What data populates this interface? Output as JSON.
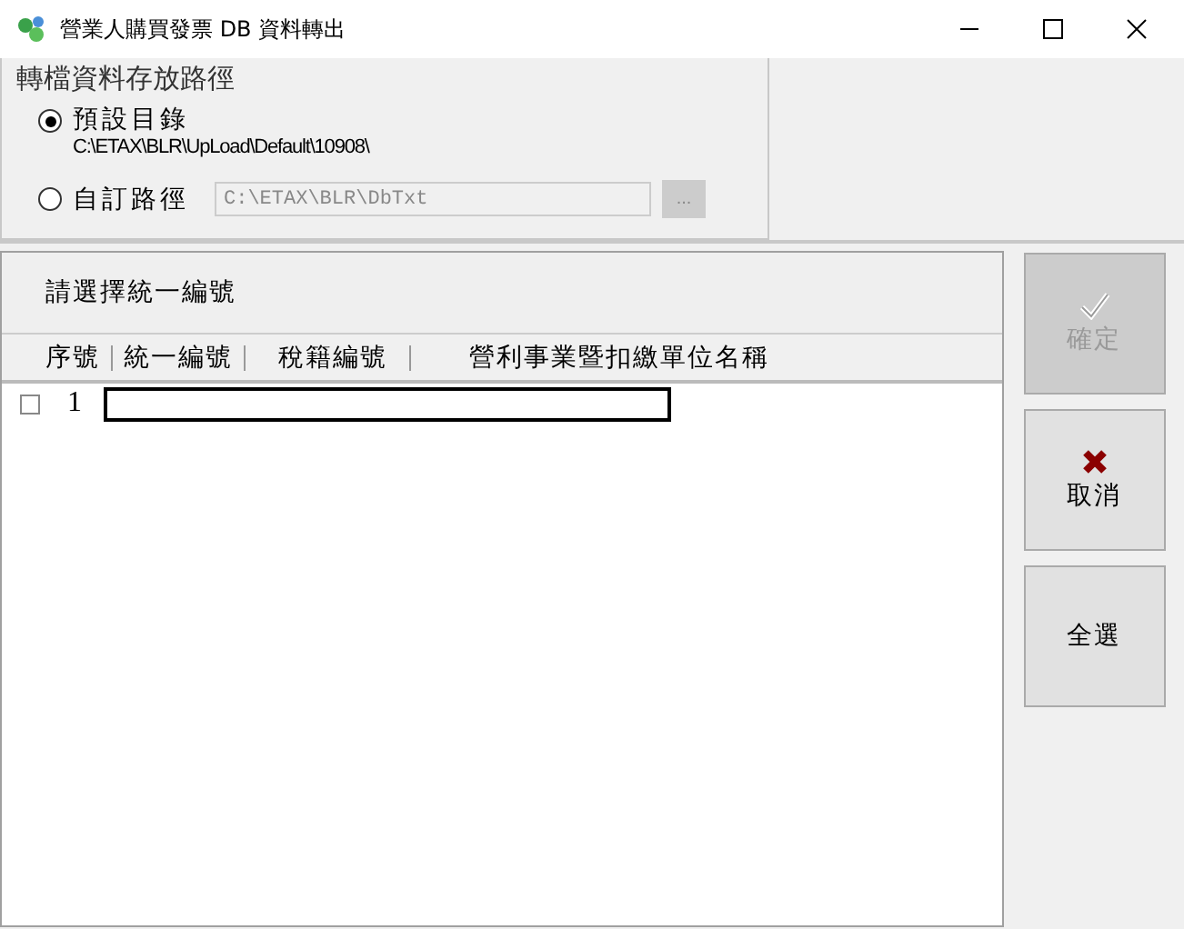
{
  "window": {
    "title": "營業人購買發票 DB 資料轉出"
  },
  "path_group": {
    "title": "轉檔資料存放路徑",
    "options": [
      {
        "kind": "default",
        "label": "預設目錄",
        "path": "C:\\ETAX\\BLR\\UpLoad\\Default\\10908\\",
        "selected": true
      },
      {
        "kind": "custom",
        "label": "自訂路徑",
        "value": "C:\\ETAX\\BLR\\DbTxt",
        "selected": false
      }
    ],
    "browse_button": "..."
  },
  "list": {
    "prompt": "請選擇統一編號",
    "columns": [
      "序號",
      "統一編號",
      "稅籍編號",
      "營利事業暨扣繳單位名稱"
    ],
    "rows": [
      {
        "checked": false,
        "number": "1"
      }
    ]
  },
  "buttons": [
    {
      "kind": "check",
      "label": "確定",
      "disabled": true
    },
    {
      "kind": "cross",
      "label": "取消",
      "disabled": false
    },
    {
      "kind": "plain",
      "label": "全選",
      "disabled": false
    }
  ]
}
